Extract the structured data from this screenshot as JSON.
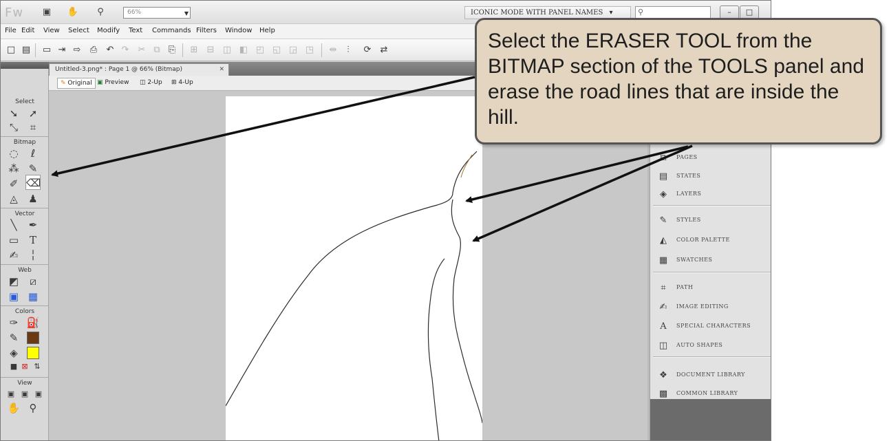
{
  "titlebar": {
    "app_logo": "Fw",
    "zoom_value": "66%",
    "workspace": "ICONIC MODE WITH PANEL NAMES",
    "workspace_dropdown": "▾",
    "search_icon": "magnifier",
    "window_buttons": [
      "–",
      "□",
      "✕"
    ]
  },
  "menubar": {
    "items": [
      "File",
      "Edit",
      "View",
      "Select",
      "Modify",
      "Text",
      "Commands",
      "Filters",
      "Window",
      "Help"
    ]
  },
  "document": {
    "tab_title": "Untitled-3.png* : Page 1 @ 66% (Bitmap)",
    "tab_close": "✕",
    "view_tabs": [
      "Original",
      "Preview",
      "2-Up",
      "4-Up"
    ],
    "selected_view": "Original"
  },
  "tools_panel": {
    "sections": [
      "Select",
      "Bitmap",
      "Vector",
      "Web",
      "Colors",
      "View"
    ],
    "active_tool": "eraser-icon",
    "stroke_color": "#6b3a12",
    "fill_color": "#ffff00"
  },
  "panels": {
    "items": [
      "PAGES",
      "STATES",
      "LAYERS",
      "STYLES",
      "COLOR PALETTE",
      "SWATCHES",
      "PATH",
      "IMAGE EDITING",
      "SPECIAL CHARACTERS",
      "AUTO SHAPES",
      "DOCUMENT LIBRARY",
      "COMMON LIBRARY"
    ]
  },
  "callout": {
    "text": " Select the ERASER TOOL from the BITMAP section of the TOOLS panel and erase the road lines that are inside the hill."
  }
}
